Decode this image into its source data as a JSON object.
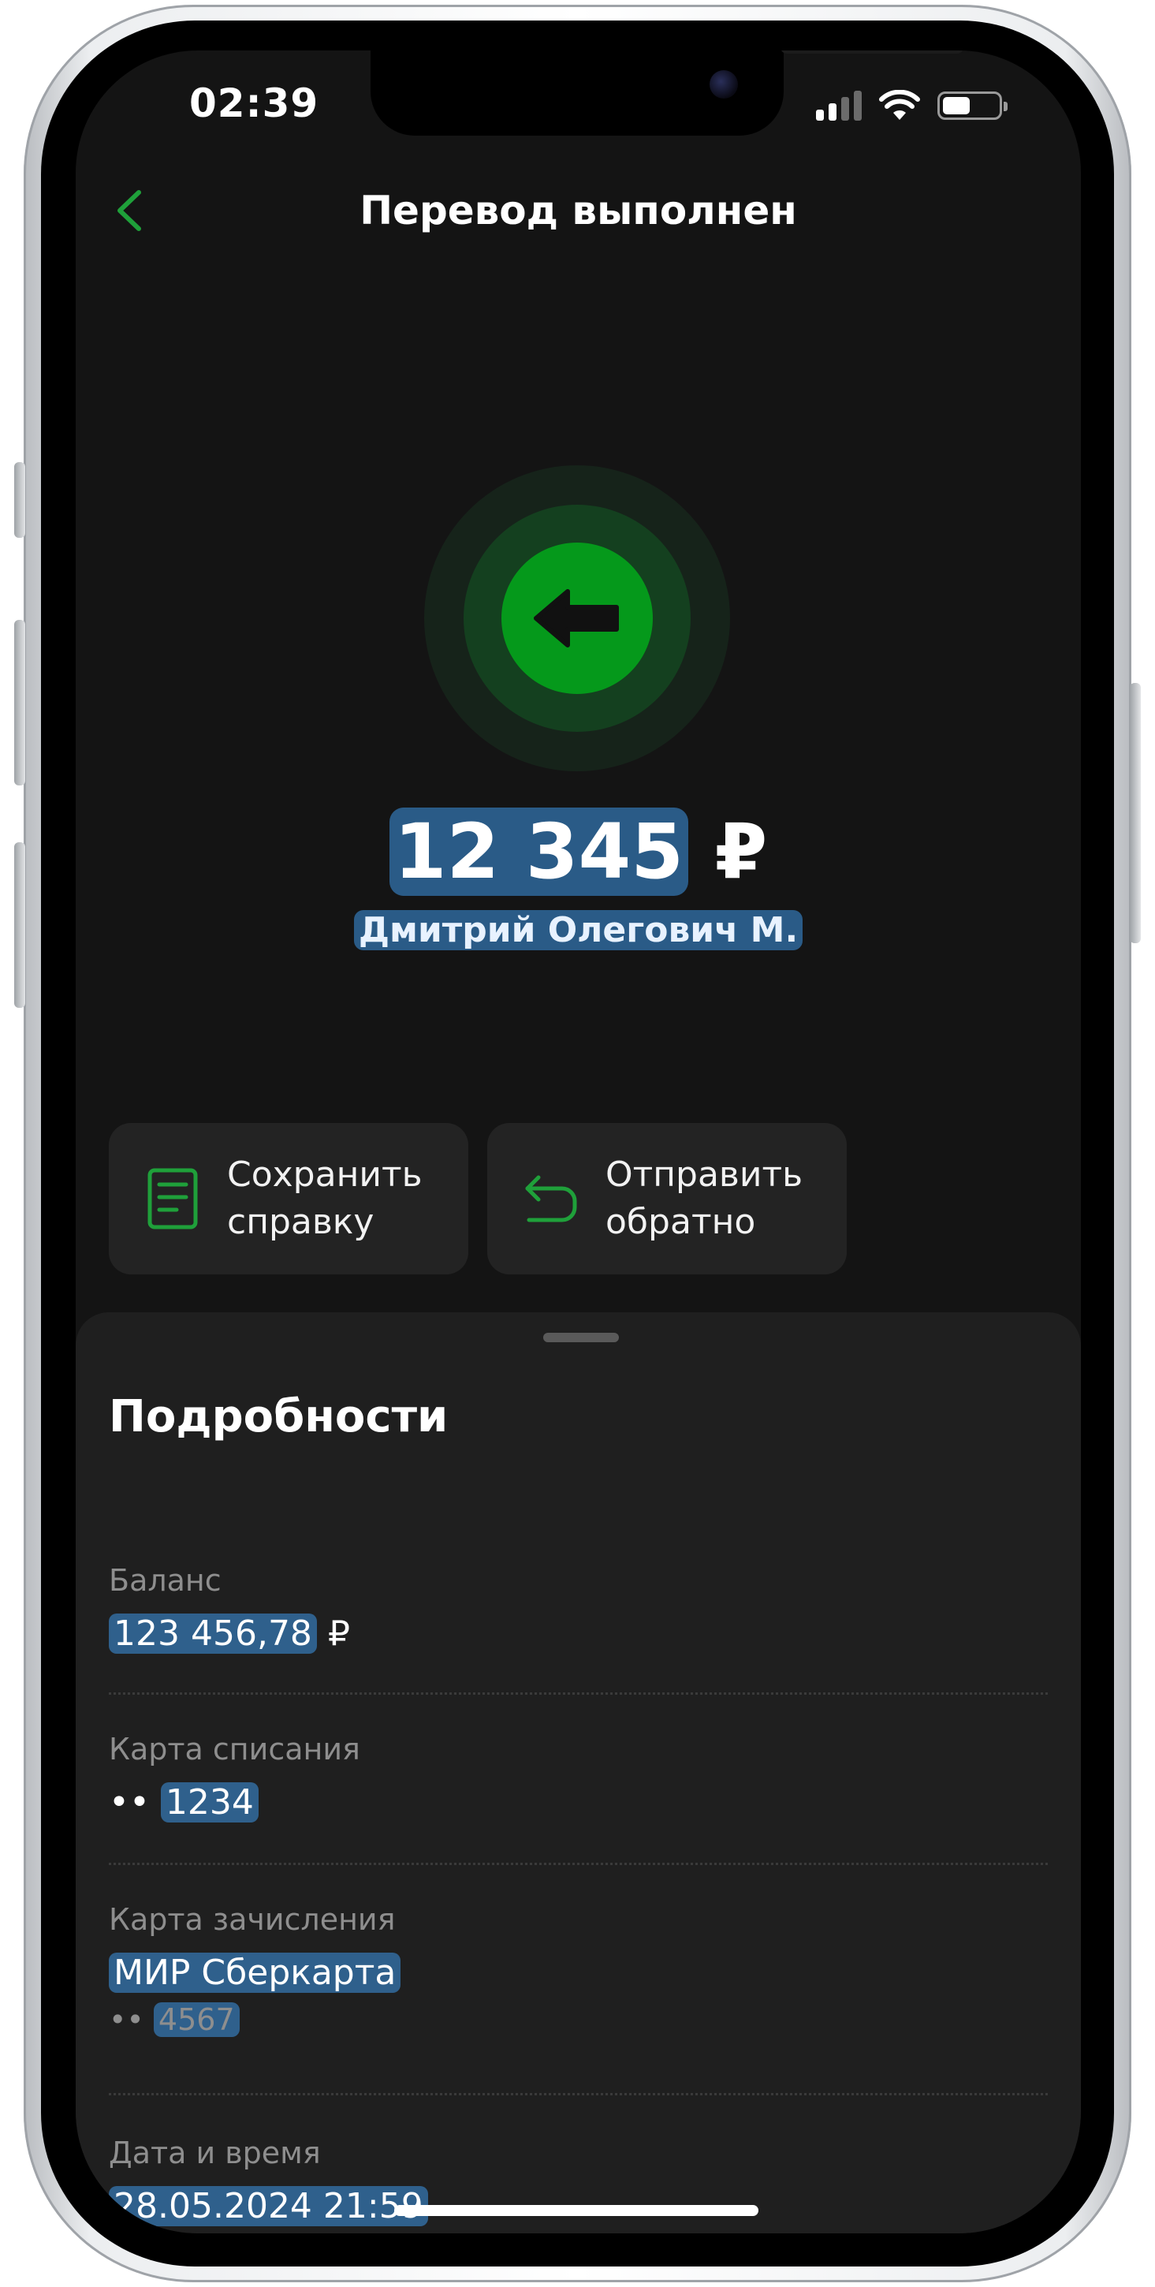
{
  "status_bar": {
    "time": "02:39"
  },
  "nav": {
    "title": "Перевод выполнен"
  },
  "transfer": {
    "amount": "12 345",
    "currency": "₽",
    "recipient": "Дмитрий Олегович М."
  },
  "actions": [
    {
      "label": "Сохранить справку"
    },
    {
      "label": "Отправить обратно"
    }
  ],
  "details": {
    "title": "Подробности",
    "balance": {
      "label": "Баланс",
      "value": "123 456,78",
      "currency": "₽"
    },
    "debit_card": {
      "label": "Карта списания",
      "dots": "••",
      "number": "1234"
    },
    "credit_card": {
      "label": "Карта зачисления",
      "name": "МИР Сберкарта",
      "dots": "••",
      "number": "4567"
    },
    "datetime": {
      "label": "Дата и время",
      "value": "28.05.2024 21:59"
    }
  },
  "colors": {
    "accent": "#05991b",
    "background": "#141414",
    "sheet": "#1f1f1f",
    "card": "#232323"
  }
}
